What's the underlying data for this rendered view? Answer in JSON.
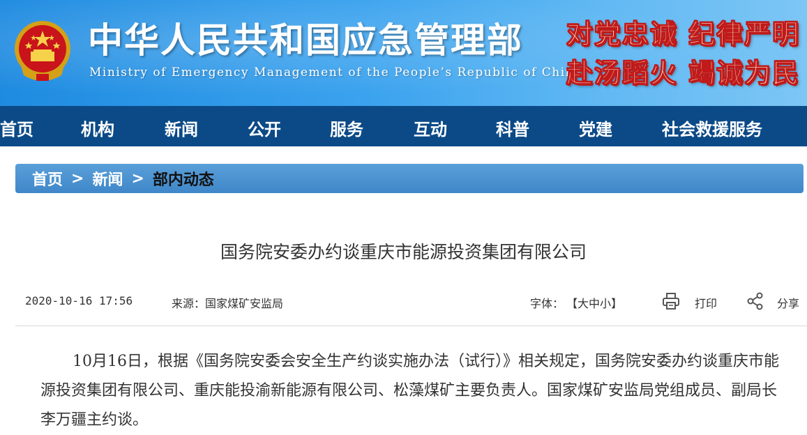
{
  "header": {
    "site_title": "中华人民共和国应急管理部",
    "site_subtitle": "Ministry of Emergency Management of the People’s Republic of China",
    "slogan_line1": "对党忠诚 纪律严明",
    "slogan_line2": "赴汤蹈火 竭诚为民",
    "emblem_icon": "national-emblem-icon",
    "colors": {
      "banner": "#2a96e8",
      "nav": "#0c4a87",
      "slogan_fill": "#fff3d6",
      "slogan_outline": "#c01a1a"
    }
  },
  "nav": {
    "items": [
      {
        "label": "首页"
      },
      {
        "label": "机构"
      },
      {
        "label": "新闻"
      },
      {
        "label": "公开"
      },
      {
        "label": "服务"
      },
      {
        "label": "互动"
      },
      {
        "label": "科普"
      },
      {
        "label": "党建"
      },
      {
        "label": "社会救援服务"
      }
    ]
  },
  "breadcrumb": {
    "items": [
      "首页",
      "新闻",
      "部内动态"
    ],
    "separator": ">"
  },
  "article": {
    "title": "国务院安委办约谈重庆市能源投资集团有限公司",
    "date": "2020-10-16 17:56",
    "source": "来源：国家煤矿安监局",
    "font_label": "字体：",
    "font_open": "【",
    "font_large": "大",
    "font_medium": "中",
    "font_small": "小",
    "font_close": "】",
    "print_label": "打印",
    "share_label": "分享",
    "body": "10月16日，根据《国务院安委会安全生产约谈实施办法（试行）》相关规定，国务院安委办约谈重庆市能源投资集团有限公司、重庆能投渝新能源有限公司、松藻煤矿主要负责人。国家煤矿安监局党组成员、副局长李万疆主约谈。"
  }
}
